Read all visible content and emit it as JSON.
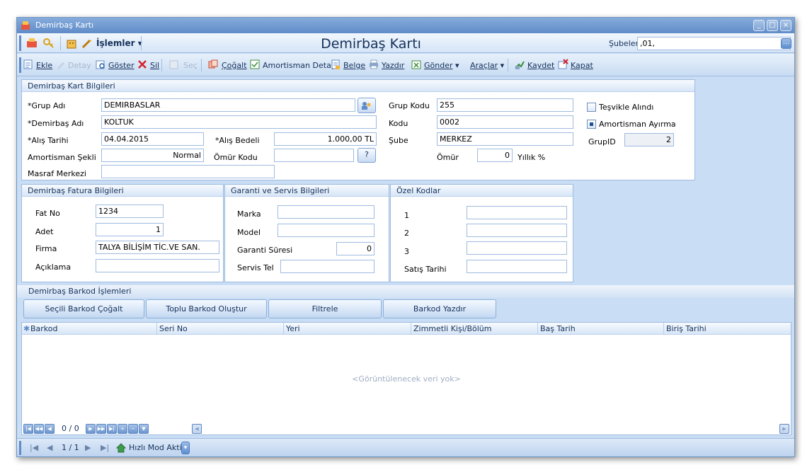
{
  "window": {
    "title": "Demirbaş Kartı"
  },
  "toolbar1": {
    "islemler_label": "İşlemler",
    "form_title": "Demirbaş Kartı",
    "subeler_label": "Şubeler",
    "subeler_value": ",01,"
  },
  "toolbar2": {
    "ekle": "Ekle",
    "detay": "Detay",
    "goster": "Göster",
    "sil": "Sil",
    "sec": "Seç",
    "cogalt": "Çoğalt",
    "amortisman_detay": "Amortisman Detay",
    "belge": "Belge",
    "yazdir": "Yazdır",
    "gonder": "Gönder",
    "araclar": "Araçlar",
    "kaydet": "Kaydet",
    "kapat": "Kapat"
  },
  "kart": {
    "header": "Demirbaş Kart Bilgileri",
    "grup_adi_label": "*Grup Adı",
    "grup_adi": "DEMIRBASLAR",
    "demirbas_adi_label": "*Demirbaş Adı",
    "demirbas_adi": "KOLTUK",
    "alis_tarihi_label": "*Alış Tarihi",
    "alis_tarihi": "04.04.2015",
    "alis_bedeli_label": "*Alış Bedeli",
    "alis_bedeli": "1.000,00 TL",
    "amortisman_sekli_label": "Amortisman Şekli",
    "amortisman_sekli": "Normal",
    "omur_kodu_label": "Ömür Kodu",
    "omur_kodu_btn": "?",
    "masraf_merkezi_label": "Masraf Merkezi",
    "grup_kodu_label": "Grup Kodu",
    "grup_kodu": "255",
    "kodu_label": "Kodu",
    "kodu": "0002",
    "sube_label": "Şube",
    "sube": "MERKEZ",
    "omur_label": "Ömür",
    "omur": "0",
    "yillik_label": "Yıllık %",
    "tesvik_label": "Teşvikle Alındı",
    "amortisman_ayirma_label": "Amortisman Ayırma",
    "grupid_label": "GrupID",
    "grupid": "2"
  },
  "fatura": {
    "header": "Demirbaş Fatura Bilgileri",
    "fat_no_label": "Fat No",
    "fat_no": "1234",
    "adet_label": "Adet",
    "adet": "1",
    "firma_label": "Firma",
    "firma": "TALYA BİLİŞİM TİC.VE SAN.",
    "aciklama_label": "Açıklama"
  },
  "garanti": {
    "header": "Garanti ve Servis Bilgileri",
    "marka_label": "Marka",
    "model_label": "Model",
    "garanti_suresi_label": "Garanti Süresi",
    "garanti_suresi": "0",
    "servis_tel_label": "Servis Tel"
  },
  "ozel": {
    "header": "Özel Kodlar",
    "k1": "1",
    "k2": "2",
    "k3": "3",
    "satis_tarihi_label": "Satış Tarihi"
  },
  "barkod": {
    "header": "Demirbaş Barkod İşlemleri",
    "btn_secili": "Seçili Barkod Çoğalt",
    "btn_toplu": "Toplu Barkod Oluştur",
    "btn_filtrele": "Filtrele",
    "btn_yazdir": "Barkod Yazdır",
    "columns": [
      "Barkod",
      "Seri No",
      "Yeri",
      "Zimmetli Kişi/Bölüm",
      "Baş Tarih",
      "Biriş Tarihi"
    ],
    "empty_message": "<Görüntülenecek veri yok>",
    "record_count": "0 / 0"
  },
  "status": {
    "page": "1 / 1",
    "hizli_mod": "Hızlı Mod Aktif"
  }
}
